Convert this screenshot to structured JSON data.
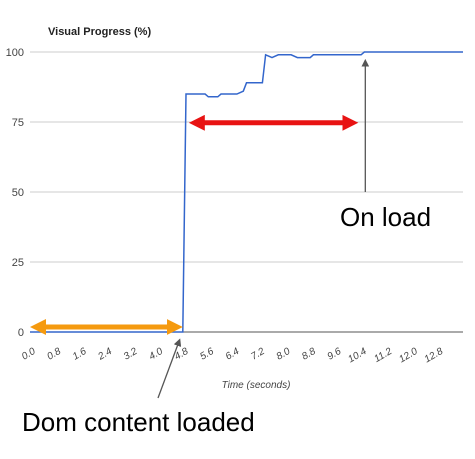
{
  "chart_data": {
    "type": "line",
    "title": "Visual Progress (%)",
    "xlabel": "Time (seconds)",
    "ylabel": "",
    "xlim": [
      0,
      13.6
    ],
    "ylim": [
      0,
      100
    ],
    "grid": true,
    "x_ticks": [
      "0.0",
      "0.8",
      "1.6",
      "2.4",
      "3.2",
      "4.0",
      "4.8",
      "5.6",
      "6.4",
      "7.2",
      "8.0",
      "8.8",
      "9.6",
      "10.4",
      "11.2",
      "12.0",
      "12.8"
    ],
    "y_ticks": [
      "0",
      "25",
      "50",
      "75",
      "100"
    ],
    "series": [
      {
        "name": "",
        "color": "#3366cc",
        "points": [
          [
            0.0,
            0
          ],
          [
            4.8,
            0
          ],
          [
            4.9,
            85
          ],
          [
            5.5,
            85
          ],
          [
            5.6,
            84
          ],
          [
            5.9,
            84
          ],
          [
            6.0,
            85
          ],
          [
            6.5,
            85
          ],
          [
            6.7,
            86
          ],
          [
            6.8,
            89
          ],
          [
            7.3,
            89
          ],
          [
            7.4,
            99
          ],
          [
            7.6,
            98
          ],
          [
            7.8,
            99
          ],
          [
            8.2,
            99
          ],
          [
            8.4,
            98
          ],
          [
            8.8,
            98
          ],
          [
            8.9,
            99
          ],
          [
            10.4,
            99
          ],
          [
            10.5,
            100
          ],
          [
            13.6,
            100
          ]
        ]
      }
    ],
    "annotations": [
      {
        "text": "On load",
        "color": "#000000"
      },
      {
        "text": "Dom content loaded",
        "color": "#000000"
      }
    ],
    "arrows": [
      {
        "from_x": 0.0,
        "to_x": 4.8,
        "y": 0,
        "color": "#f59a0f"
      },
      {
        "from_x": 4.8,
        "to_x": 10.5,
        "y": 74,
        "color": "#e81313"
      }
    ],
    "pointer_arrows": [
      {
        "to_x": 10.5,
        "to_y": 99,
        "color": "#555555"
      },
      {
        "to_x": 4.8,
        "to_y": 0,
        "color": "#555555"
      }
    ]
  }
}
